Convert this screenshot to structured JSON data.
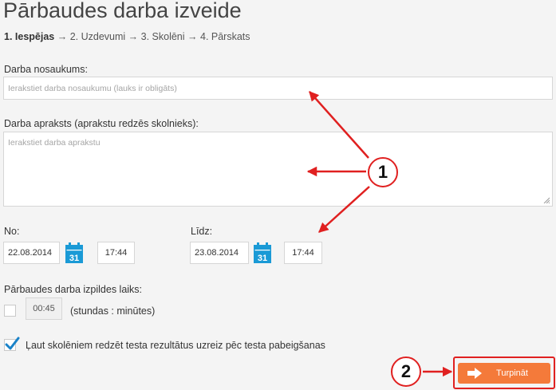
{
  "page": {
    "title": "Pārbaudes darba izveide"
  },
  "steps": {
    "step1": "1.  Iespējas",
    "sep1": " → ",
    "step2": "2.  Uzdevumi",
    "sep2": " → ",
    "step3": "3.  Skolēni",
    "sep3": " → ",
    "step4": "4.  Pārskats"
  },
  "form": {
    "name_label": "Darba nosaukums:",
    "name_placeholder": "Ierakstiet darba nosaukumu (lauks ir obligāts)",
    "desc_label": "Darba apraksts (aprakstu redzēs skolnieks):",
    "desc_placeholder": "Ierakstiet darba aprakstu",
    "from_label": "No:",
    "from_date": "22.08.2014",
    "from_time": "17:44",
    "to_label": "Līdz:",
    "to_date": "23.08.2014",
    "to_time": "17:44",
    "calendar_day": "31",
    "duration_label": "Pārbaudes darba izpildes laiks:",
    "duration_value": "00:45",
    "duration_hint": "(stundas : minūtes)",
    "duration_checked": false,
    "results_label": "Ļaut skolēniem redzēt testa rezultātus uzreiz pēc testa pabeigšanas",
    "results_checked": true
  },
  "actions": {
    "continue_label": "Turpināt"
  },
  "annotations": {
    "badge1": "1",
    "badge2": "2"
  },
  "icons": {
    "calendar": "calendar-icon",
    "arrow": "arrow-right-icon",
    "check": "checkmark-icon"
  },
  "colors": {
    "accent": "#f47a3a",
    "calendar_blue": "#1a9ad6",
    "annotation_red": "#e02020",
    "check_blue": "#1a82c8"
  }
}
